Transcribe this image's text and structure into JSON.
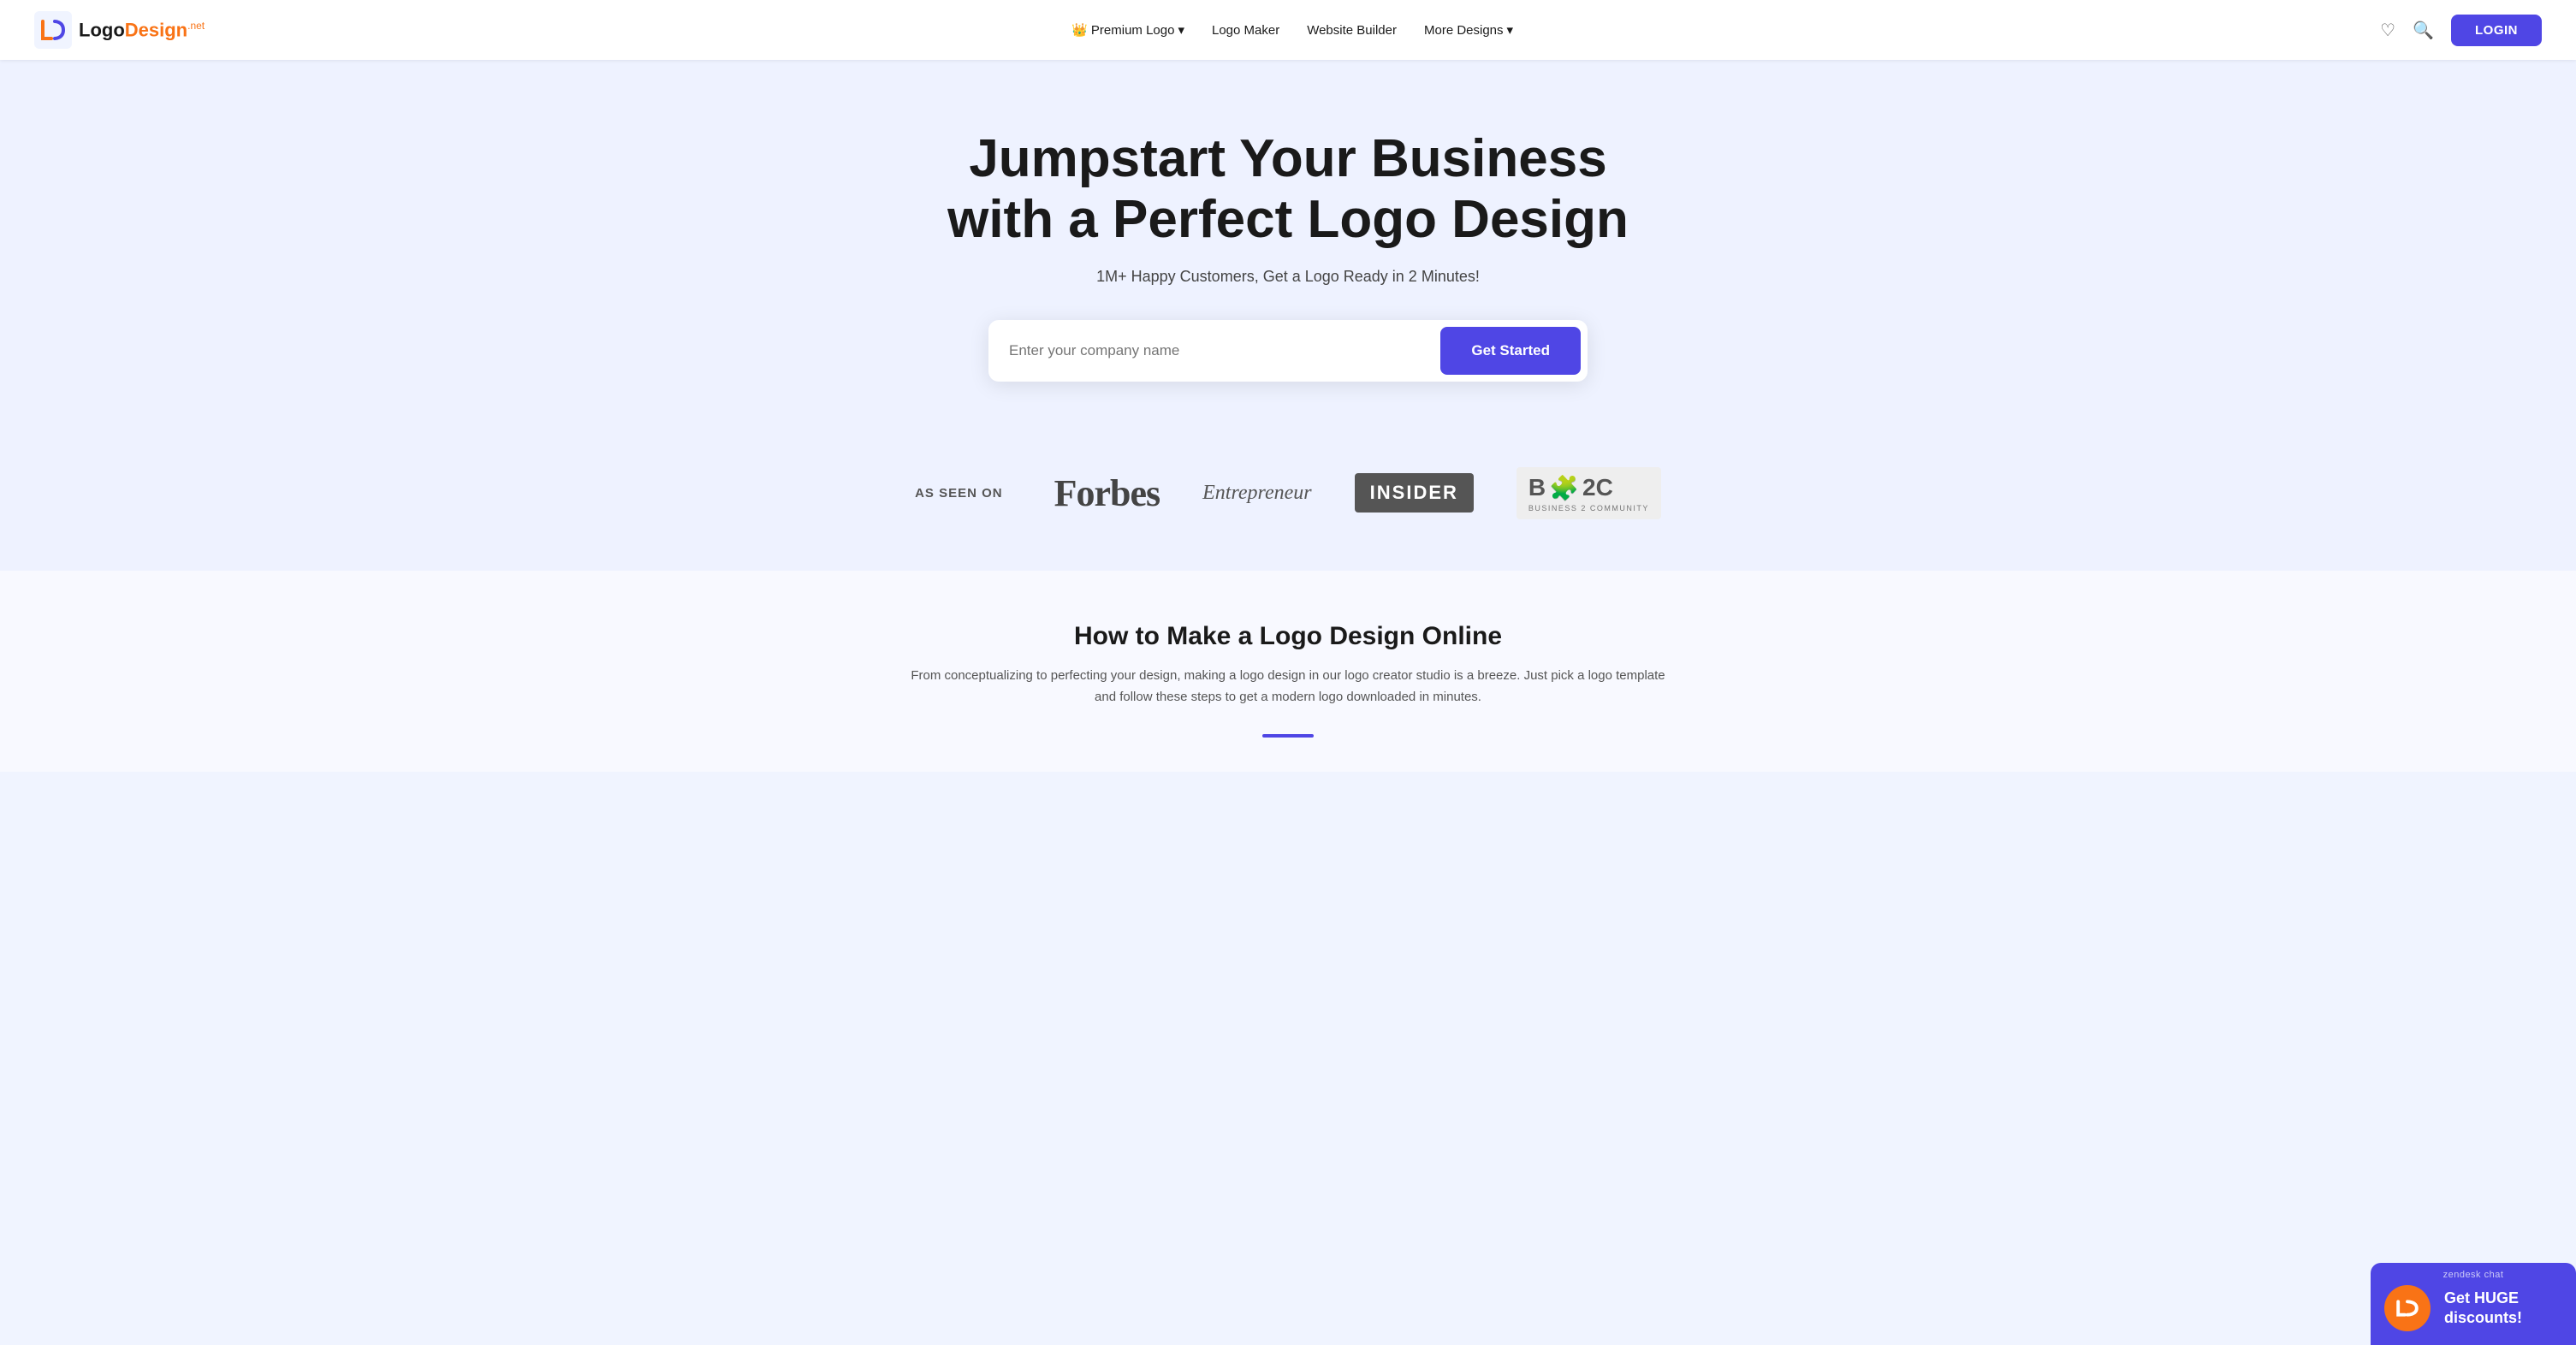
{
  "navbar": {
    "logo_text": "Logo",
    "logo_suffix": "Design",
    "logo_net": ".net",
    "nav_items": [
      {
        "label": "Premium Logo",
        "has_dropdown": true,
        "has_crown": true
      },
      {
        "label": "Logo Maker",
        "has_dropdown": false,
        "has_crown": false
      },
      {
        "label": "Website Builder",
        "has_dropdown": false,
        "has_crown": false
      },
      {
        "label": "More Designs",
        "has_dropdown": true,
        "has_crown": false
      }
    ],
    "login_label": "LOGIN"
  },
  "hero": {
    "title_line1": "Jumpstart Your Business",
    "title_line2": "with a Perfect Logo Design",
    "subtitle": "1M+ Happy Customers, Get a Logo Ready in 2 Minutes!",
    "input_placeholder": "Enter your company name",
    "cta_label": "Get Started"
  },
  "as_seen_on": {
    "label": "AS SEEN ON",
    "brands": [
      {
        "name": "Forbes"
      },
      {
        "name": "Entrepreneur"
      },
      {
        "name": "INSIDER"
      },
      {
        "name": "B2C",
        "subtitle": "BUSINESS 2 COMMUNITY"
      }
    ]
  },
  "how_to": {
    "title": "How to Make a Logo Design Online",
    "description": "From conceptualizing to perfecting your design, making a logo design in our logo creator studio is a breeze. Just pick a logo template and follow these steps to get a modern logo downloaded in minutes."
  },
  "zendesk": {
    "label": "zendesk chat",
    "text": "Get HUGE discounts!"
  }
}
